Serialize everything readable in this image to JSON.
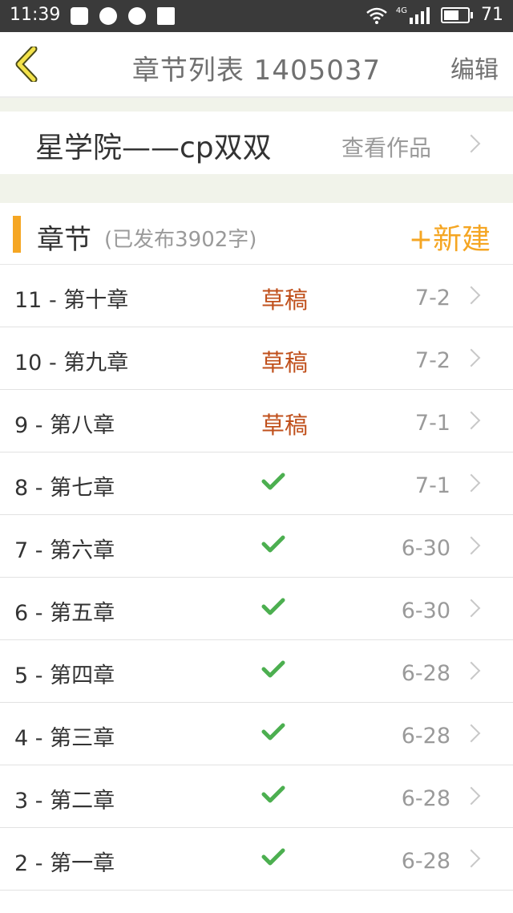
{
  "status_bar": {
    "time": "11:39",
    "network": "4G",
    "battery_level": "71"
  },
  "nav": {
    "title": "章节列表  1405037",
    "edit_label": "编辑"
  },
  "work": {
    "name": "星学院——cp双双",
    "view_label": "查看作品"
  },
  "section": {
    "title": "章节",
    "subtitle": "(已发布3902字)",
    "new_label": "+新建",
    "accent_color": "#f5a623"
  },
  "chapters": [
    {
      "title": "11 - 第十章",
      "status": "草稿",
      "date": "7-2"
    },
    {
      "title": "10 - 第九章",
      "status": "草稿",
      "date": "7-2"
    },
    {
      "title": "9 - 第八章",
      "status": "草稿",
      "date": "7-1"
    },
    {
      "title": "8 - 第七章",
      "status": "published",
      "date": "7-1"
    },
    {
      "title": "7 - 第六章",
      "status": "published",
      "date": "6-30"
    },
    {
      "title": "6 - 第五章",
      "status": "published",
      "date": "6-30"
    },
    {
      "title": "5 - 第四章",
      "status": "published",
      "date": "6-28"
    },
    {
      "title": "4 - 第三章",
      "status": "published",
      "date": "6-28"
    },
    {
      "title": "3 - 第二章",
      "status": "published",
      "date": "6-28"
    },
    {
      "title": "2 - 第一章",
      "status": "published",
      "date": "6-28"
    }
  ]
}
